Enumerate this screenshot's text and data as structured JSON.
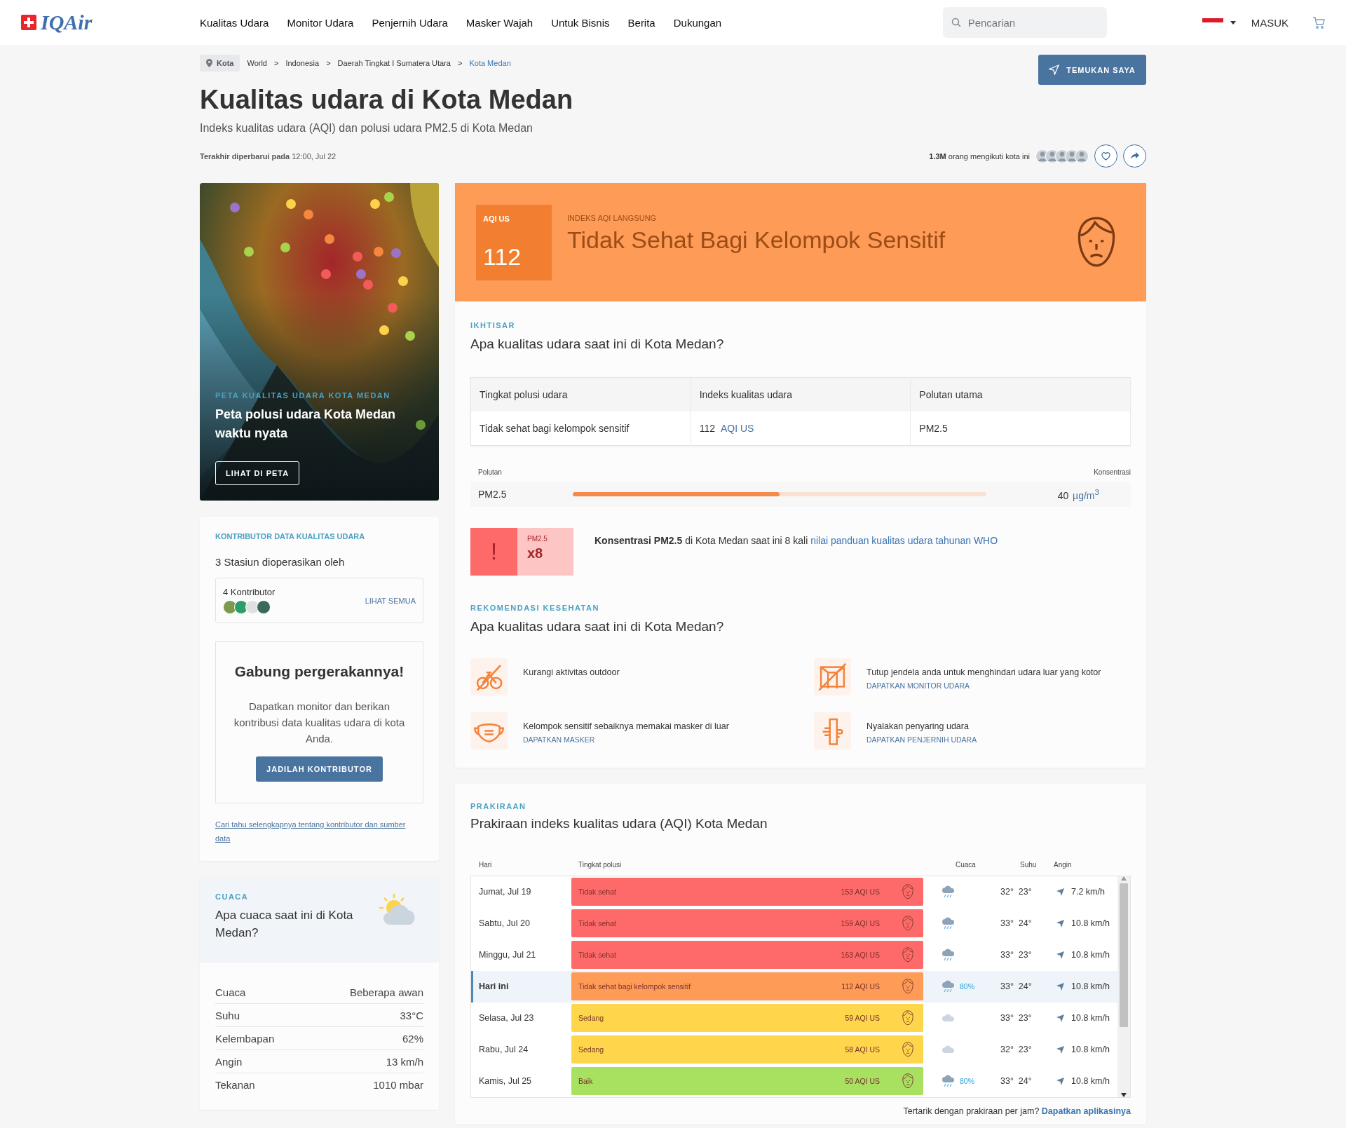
{
  "header": {
    "logo": "IQAir",
    "nav": [
      "Kualitas Udara",
      "Monitor Udara",
      "Penjernih Udara",
      "Masker Wajah",
      "Untuk Bisnis",
      "Berita",
      "Dukungan"
    ],
    "search": {
      "placeholder": "Pencarian"
    },
    "login": "MASUK"
  },
  "breadcrumb": {
    "badge": "Kota",
    "separator": ">",
    "items": [
      {
        "label": "World",
        "current": false
      },
      {
        "label": "Indonesia",
        "current": false
      },
      {
        "label": "Daerah Tingkat I Sumatera Utara",
        "current": false
      },
      {
        "label": "Kota Medan",
        "current": true
      }
    ]
  },
  "locate_button": "TEMUKAN SAYA",
  "title": "Kualitas udara di Kota Medan",
  "subtitle": "Indeks kualitas udara (AQI) dan polusi udara PM2.5 di Kota Medan",
  "updated": "**Terakhir diperbarui pada** 12:00, Jul 22",
  "followers": "**1.3M** orang mengikuti kota ini",
  "map_card": {
    "kind": "picture",
    "kicker": "PETA KUALITAS UDARA KOTA MEDAN",
    "title": "Peta polusi udara Kota Medan waktu nyata",
    "button": "LIHAT DI PETA"
  },
  "contributors": {
    "kicker": "KONTRIBUTOR DATA KUALITAS UDARA",
    "stations": "3 Stasiun dioperasikan oleh",
    "count": "4 Kontributor",
    "see_all": "LIHAT SEMUA",
    "join": {
      "title": "Gabung pergerakannya!",
      "text": "Dapatkan monitor dan berikan kontribusi data kualitas udara di kota Anda.",
      "button": "JADILAH KONTRIBUTOR"
    },
    "footer_link": "Cari tahu selengkapnya tentang kontributor dan sumber data"
  },
  "weather": {
    "kicker": "CUACA",
    "question": "Apa cuaca saat ini di Kota Medan?",
    "rows": [
      {
        "label": "Cuaca",
        "value": "Beberapa awan"
      },
      {
        "label": "Suhu",
        "value": "33°C"
      },
      {
        "label": "Kelembapan",
        "value": "62%"
      },
      {
        "label": "Angin",
        "value": "13 km/h"
      },
      {
        "label": "Tekanan",
        "value": "1010 mbar"
      }
    ]
  },
  "aqi": {
    "label": "AQI US",
    "value": "112",
    "kicker": "INDEKS AQI LANGSUNG",
    "status": "Tidak Sehat Bagi Kelompok Sensitif",
    "color": "#fe9b57"
  },
  "overview": {
    "kicker": "IKHTISAR",
    "question": "Apa kualitas udara saat ini di Kota Medan?",
    "columns": [
      "Tingkat polusi udara",
      "Indeks kualitas udara",
      "Polutan utama"
    ],
    "level": "Tidak sehat bagi kelompok sensitif",
    "index": "112",
    "index_unit": "AQI US",
    "pollutant": "PM2.5"
  },
  "pollutant": {
    "header_left": "Polutan",
    "header_right": "Konsentrasi",
    "name": "PM2.5",
    "level": 0.5,
    "value": "40",
    "unit": "µg/m$^{3}$"
  },
  "who": {
    "mark": "!",
    "label": "PM2.5",
    "multiplier": "x8",
    "text": "**Konsentrasi PM2.5** di Kota Medan saat ini 8 kali",
    "link": "nilai panduan kualitas udara tahunan WHO"
  },
  "recommendations": {
    "kicker": "REKOMENDASI KESEHATAN",
    "question": "Apa kualitas udara saat ini di Kota Medan?",
    "items": [
      {
        "kind": "bike",
        "text": "Kurangi aktivitas outdoor"
      },
      {
        "kind": "window",
        "text": "Tutup jendela anda untuk menghindari udara luar yang kotor",
        "link": "DAPATKAN MONITOR UDARA"
      },
      {
        "kind": "mask",
        "text": "Kelompok sensitif sebaiknya memakai masker di luar",
        "link": "DAPATKAN MASKER"
      },
      {
        "kind": "purifier",
        "text": "Nyalakan penyaring udara",
        "link": "DAPATKAN PENJERNIH UDARA"
      }
    ]
  },
  "forecast": {
    "kicker": "PRAKIRAAN",
    "title": "Prakiraan indeks kualitas udara (AQI) Kota Medan",
    "columns": [
      "Hari",
      "Tingkat polusi",
      "Cuaca",
      "Suhu",
      "Angin"
    ],
    "rows": [
      {
        "day": "Jumat, Jul 19",
        "selected": false,
        "level": "Tidak sehat",
        "aqi": "153 AQI US",
        "color": "#fe6a69",
        "kind": "rain",
        "high": "32°",
        "low": "23°",
        "wind": "7.2 km/h"
      },
      {
        "day": "Sabtu, Jul 20",
        "selected": false,
        "level": "Tidak sehat",
        "aqi": "159 AQI US",
        "color": "#fe6a69",
        "kind": "rain",
        "high": "33°",
        "low": "24°",
        "wind": "10.8 km/h"
      },
      {
        "day": "Minggu, Jul 21",
        "selected": false,
        "level": "Tidak sehat",
        "aqi": "163 AQI US",
        "color": "#fe6a69",
        "kind": "rain",
        "high": "33°",
        "low": "23°",
        "wind": "10.8 km/h"
      },
      {
        "day": "Hari ini",
        "selected": true,
        "level": "Tidak sehat bagi kelompok sensitif",
        "aqi": "112 AQI US",
        "color": "#fe9b57",
        "kind": "rain",
        "precip": "80%",
        "high": "33°",
        "low": "24°",
        "wind": "10.8 km/h"
      },
      {
        "day": "Selasa, Jul 23",
        "selected": false,
        "level": "Sedang",
        "aqi": "59 AQI US",
        "color": "#fdd64b",
        "kind": "cloud",
        "high": "33°",
        "low": "23°",
        "wind": "10.8 km/h"
      },
      {
        "day": "Rabu, Jul 24",
        "selected": false,
        "level": "Sedang",
        "aqi": "58 AQI US",
        "color": "#fdd64b",
        "kind": "cloud",
        "high": "32°",
        "low": "23°",
        "wind": "10.8 km/h"
      },
      {
        "day": "Kamis, Jul 25",
        "selected": false,
        "level": "Baik",
        "aqi": "50 AQI US",
        "color": "#a8e05f",
        "kind": "rain",
        "precip": "80%",
        "high": "33°",
        "low": "24°",
        "wind": "10.8 km/h"
      }
    ],
    "footer": "Tertarik dengan prakiraan per jam?",
    "footer_link": "Dapatkan aplikasinya"
  }
}
